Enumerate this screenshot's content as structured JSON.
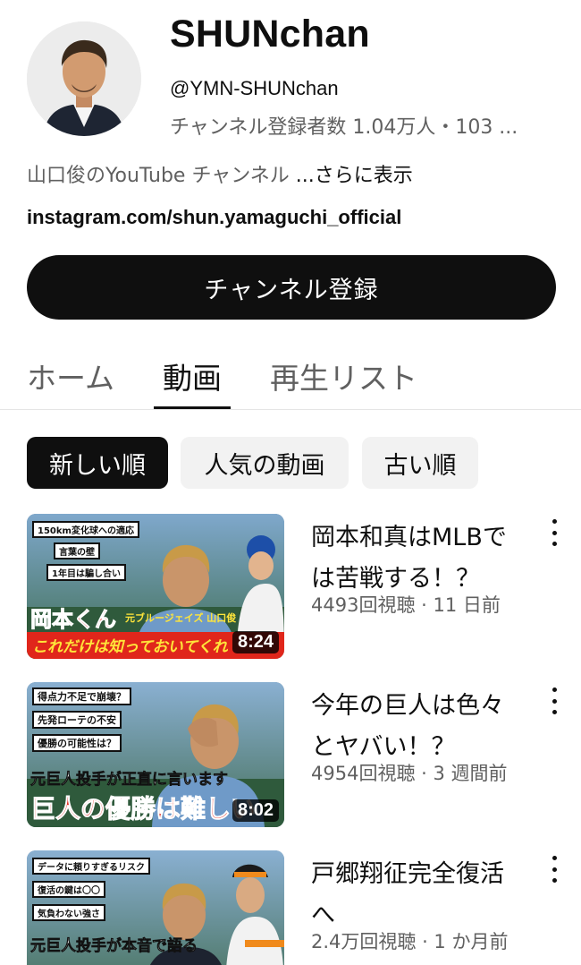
{
  "channel": {
    "name": "SHUNchan",
    "handle": "@YMN-SHUNchan",
    "stats": "チャンネル登録者数 1.04万人・103 ...",
    "description": "山口俊のYouTube チャンネル ",
    "description_more": "...さらに表示",
    "link": "instagram.com/shun.yamaguchi_official",
    "subscribe_label": "チャンネル登録"
  },
  "tabs": [
    {
      "label": "ホーム",
      "active": false
    },
    {
      "label": "動画",
      "active": true
    },
    {
      "label": "再生リスト",
      "active": false
    }
  ],
  "filters": [
    {
      "label": "新しい順",
      "selected": true
    },
    {
      "label": "人気の動画",
      "selected": false
    },
    {
      "label": "古い順",
      "selected": false
    }
  ],
  "videos": [
    {
      "title_line1": "岡本和真はMLBで",
      "title_line2": "は苦戦する！？",
      "meta": "4493回視聴 · 11 日前",
      "duration": "8:24",
      "thumb_text": [
        "150km変化球への適応",
        "言葉の壁",
        "1年目は騙し合い",
        "岡本くん",
        "元ブルージェイズ 山口俊",
        "これだけは知っておいてくれ"
      ]
    },
    {
      "title_line1": "今年の巨人は色々",
      "title_line2": "とヤバい！？",
      "meta": "4954回視聴 · 3 週間前",
      "duration": "8:02",
      "thumb_text": [
        "得点力不足で崩壊？",
        "先発ローテの不安",
        "優勝の可能性は？",
        "元巨人投手が正直に言います",
        "巨人の優勝は難しい"
      ]
    },
    {
      "title_line1": "戸郷翔征完全復活",
      "title_line2": "へ",
      "meta": "2.4万回視聴 · 1 か月前",
      "duration": "",
      "thumb_text": [
        "データに頼りすぎるリスク",
        "復活の鍵は〇〇",
        "気負わない強さ",
        "元巨人投手が本音で語る"
      ]
    }
  ],
  "colors": {
    "text_primary": "#0f0f0f",
    "text_secondary": "#606060",
    "chip_bg": "#f2f2f2",
    "thumb_red": "#e0261b",
    "thumb_yellow": "#ffe53a"
  }
}
